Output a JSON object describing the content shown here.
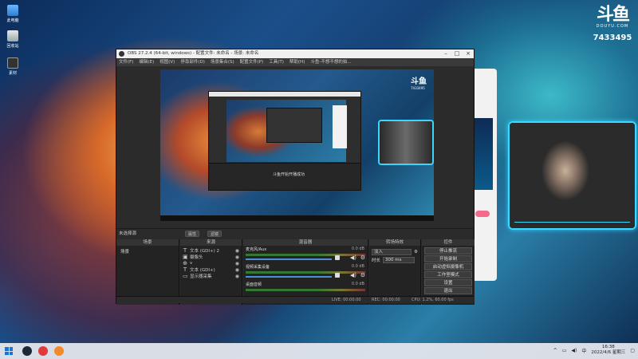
{
  "desktop": {
    "icons": [
      {
        "label": "此电脑"
      },
      {
        "label": "回收站"
      },
      {
        "label": "素材"
      }
    ]
  },
  "douyu": {
    "logo": "斗鱼",
    "site": "DOUYU.COM",
    "room_id": "7433495"
  },
  "obs": {
    "title": "OBS 27.2.4 (64-bit, windows) - 配置文件: 未命名 - 场景: 未命名",
    "menu": [
      "文件(F)",
      "编辑(E)",
      "视图(V)",
      "停靠部件(D)",
      "场景集合(S)",
      "配置文件(P)",
      "工具(T)",
      "帮助(H)",
      "斗鱼-不想不想的拍..."
    ],
    "preview_logo": "斗鱼",
    "preview_logo_sub": "7433495",
    "nested_text": "斗鱼开始开播成功",
    "toolbar": {
      "no_source": "未选择源",
      "btn_properties": "属性",
      "btn_filters": "滤镜"
    },
    "scenes": {
      "title": "场景",
      "items": [
        "场景"
      ]
    },
    "sources": {
      "title": "来源",
      "items": [
        {
          "icon": "T",
          "name": "文本 (GDI+) 2"
        },
        {
          "icon": "▣",
          "name": "摄像头"
        },
        {
          "icon": "⊕",
          "name": "v"
        },
        {
          "icon": "T",
          "name": "文本 (GDI+)"
        },
        {
          "icon": "▭",
          "name": "显示器采集"
        }
      ]
    },
    "mixer": {
      "title": "混音器",
      "channels": [
        {
          "name": "麦克风/Aux",
          "db": "0.0 dB"
        },
        {
          "name": "视频采集设备",
          "db": "0.0 dB"
        },
        {
          "name": "桌面音频",
          "db": "0.0 dB"
        }
      ]
    },
    "transitions": {
      "title": "转场特效",
      "type": "淡入",
      "duration_label": "时长",
      "duration": "300 ms"
    },
    "controls": {
      "title": "控件",
      "buttons": [
        "停止推流",
        "开始录制",
        "启动虚拟摄像机",
        "工作室模式",
        "设置",
        "退出"
      ]
    },
    "status": {
      "live": "LIVE: 00:00:00",
      "rec": "REC: 00:00:00",
      "cpu": "CPU: 1.2%, 60.00 fps"
    }
  },
  "taskbar": {
    "time": "16:38",
    "date": "2022/4/6 星期三"
  },
  "colors": {
    "cam_border": "#38d8ff",
    "obs_bg": "#2b2b2b",
    "accent_blue": "#1a73d9"
  }
}
